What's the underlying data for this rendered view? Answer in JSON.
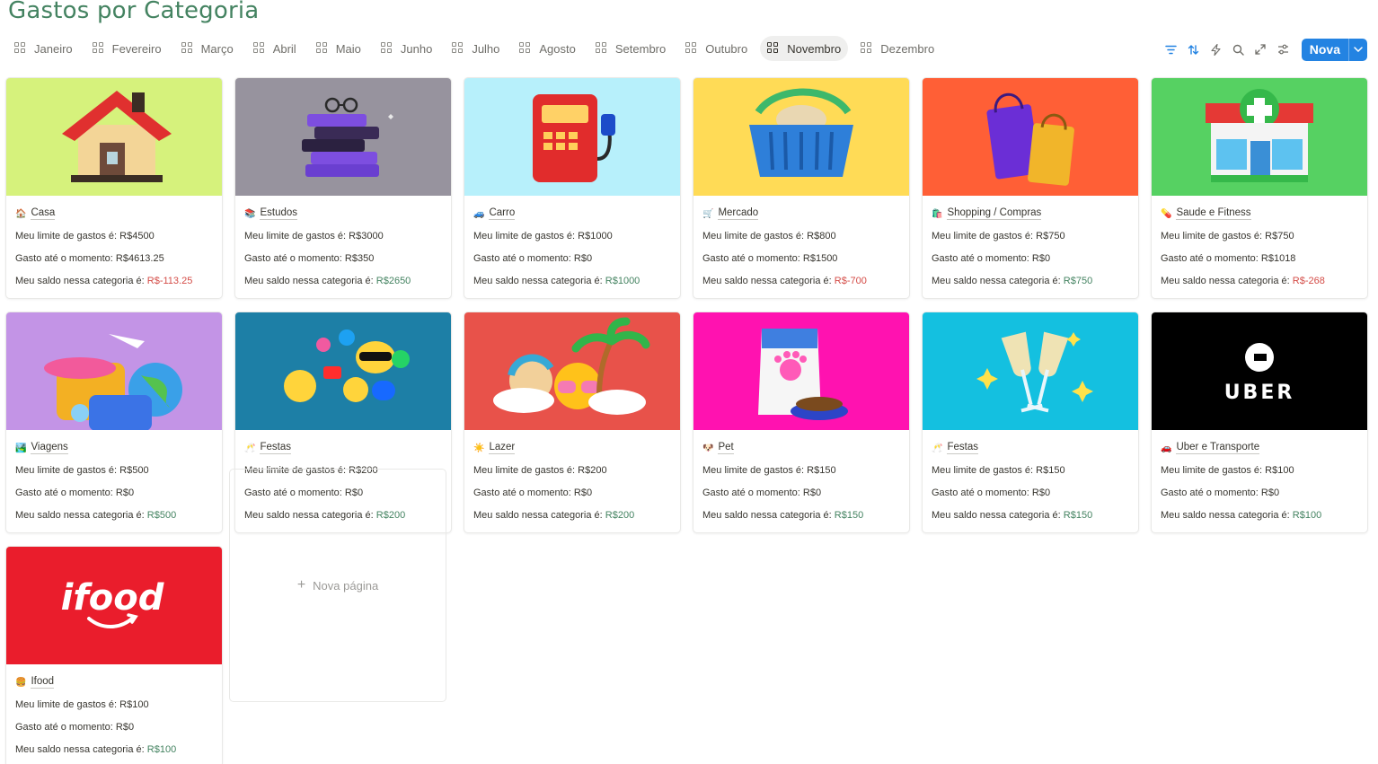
{
  "page": {
    "title": "Gastos por Categoria"
  },
  "tabs": [
    {
      "label": "Janeiro",
      "active": false
    },
    {
      "label": "Fevereiro",
      "active": false
    },
    {
      "label": "Março",
      "active": false
    },
    {
      "label": "Abril",
      "active": false
    },
    {
      "label": "Maio",
      "active": false
    },
    {
      "label": "Junho",
      "active": false
    },
    {
      "label": "Julho",
      "active": false
    },
    {
      "label": "Agosto",
      "active": false
    },
    {
      "label": "Setembro",
      "active": false
    },
    {
      "label": "Outubro",
      "active": false
    },
    {
      "label": "Novembro",
      "active": true
    },
    {
      "label": "Dezembro",
      "active": false
    }
  ],
  "toolbar": {
    "icons": [
      "filter-icon",
      "sort-icon",
      "automation-icon",
      "search-icon",
      "expand-icon",
      "settings-icon"
    ],
    "new_label": "Nova"
  },
  "labels": {
    "limit_prefix": "Meu limite de gastos é: ",
    "spent_prefix": "Gasto até o momento: ",
    "balance_prefix": "Meu saldo nessa categoria é: ",
    "new_page": "Nova página"
  },
  "colors": {
    "positive": "#448361",
    "negative": "#d44c47",
    "accent": "#2383e2"
  },
  "cards": [
    {
      "name": "Casa",
      "emoji": "🏠",
      "limit": "R$4500",
      "spent": "R$4613.25",
      "balance": "R$-113.25",
      "negative": true,
      "cover": "house",
      "bg": "#d6f27c"
    },
    {
      "name": "Estudos",
      "emoji": "📚",
      "limit": "R$3000",
      "spent": "R$350",
      "balance": "R$2650",
      "negative": false,
      "cover": "books",
      "bg": "#97939e"
    },
    {
      "name": "Carro",
      "emoji": "🚙",
      "limit": "R$1000",
      "spent": "R$0",
      "balance": "R$1000",
      "negative": false,
      "cover": "fuel",
      "bg": "#b7f0fb"
    },
    {
      "name": "Mercado",
      "emoji": "🛒",
      "limit": "R$800",
      "spent": "R$1500",
      "balance": "R$-700",
      "negative": true,
      "cover": "basket",
      "bg": "#ffdb56"
    },
    {
      "name": "Shopping / Compras",
      "emoji": "🛍️",
      "limit": "R$750",
      "spent": "R$0",
      "balance": "R$750",
      "negative": false,
      "cover": "bags",
      "bg": "#ff5f36"
    },
    {
      "name": "Saude e Fitness",
      "emoji": "💊",
      "limit": "R$750",
      "spent": "R$1018",
      "balance": "R$-268",
      "negative": true,
      "cover": "pharmacy",
      "bg": "#56d162"
    },
    {
      "name": "Viagens",
      "emoji": "🏞️",
      "limit": "R$500",
      "spent": "R$0",
      "balance": "R$500",
      "negative": false,
      "cover": "travel",
      "bg": "#c394e6"
    },
    {
      "name": "Festas",
      "emoji": "🥂",
      "limit": "R$200",
      "spent": "R$0",
      "balance": "R$200",
      "negative": false,
      "cover": "social",
      "bg": "#1d7fa6"
    },
    {
      "name": "Lazer",
      "emoji": "☀️",
      "limit": "R$200",
      "spent": "R$0",
      "balance": "R$200",
      "negative": false,
      "cover": "beach",
      "bg": "#e8524a"
    },
    {
      "name": "Pet",
      "emoji": "🐶",
      "limit": "R$150",
      "spent": "R$0",
      "balance": "R$150",
      "negative": false,
      "cover": "petfood",
      "bg": "#ff12b0"
    },
    {
      "name": "Festas",
      "emoji": "🥂",
      "limit": "R$150",
      "spent": "R$0",
      "balance": "R$150",
      "negative": false,
      "cover": "champagne",
      "bg": "#14c0e0"
    },
    {
      "name": "Uber e Transporte",
      "emoji": "🚗",
      "limit": "R$100",
      "spent": "R$0",
      "balance": "R$100",
      "negative": false,
      "cover": "uber",
      "bg": "#000000",
      "cover_text": "UBER"
    },
    {
      "name": "Ifood",
      "emoji": "🍔",
      "limit": "R$100",
      "spent": "R$0",
      "balance": "R$100",
      "negative": false,
      "cover": "ifood",
      "bg": "#ea1d2c",
      "cover_text": "ifood"
    }
  ]
}
